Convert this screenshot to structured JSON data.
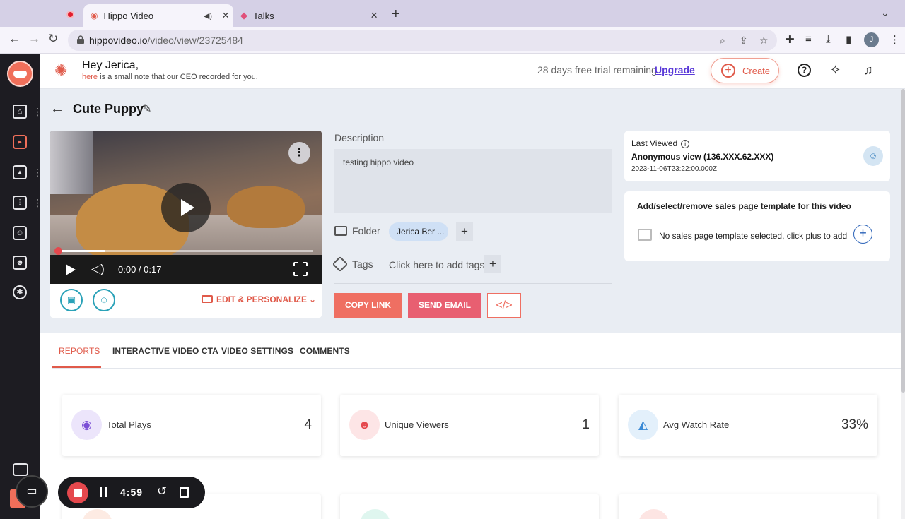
{
  "browser": {
    "tabs": [
      {
        "title": "Hippo Video",
        "active": true
      },
      {
        "title": "Talks",
        "active": false
      }
    ],
    "url_host": "hippovideo.io",
    "url_path": "/video/view/23725484",
    "profile_initial": "J"
  },
  "header": {
    "greeting": "Hey Jerica,",
    "note_link": "here",
    "note_rest": " is a small note that our CEO recorded for you.",
    "trial_text": "28 days free trial remaining.",
    "upgrade_label": "Upgrade",
    "create_label": "Create"
  },
  "video": {
    "title": "Cute Puppy",
    "time_display": "0:00 / 0:17",
    "progress": 0.18,
    "edit_personalize_label": "EDIT & PERSONALIZE"
  },
  "details": {
    "description_label": "Description",
    "description_text": "testing hippo video",
    "folder_label": "Folder",
    "folder_value": "Jerica Ber ...",
    "tags_label": "Tags",
    "tags_placeholder": "Click here to add tags",
    "copy_link_label": "COPY LINK",
    "send_email_label": "SEND EMAIL",
    "embed_label": "</>"
  },
  "last_viewed": {
    "label": "Last Viewed",
    "viewer": "Anonymous view (136.XXX.62.XXX)",
    "timestamp": "2023-11-06T23:22:00.000Z"
  },
  "sales_page": {
    "title": "Add/select/remove sales page template for this video",
    "empty_text": "No sales page template selected, click plus to add"
  },
  "report_tabs": [
    "REPORTS",
    "INTERACTIVE VIDEO CTA",
    "VIDEO SETTINGS",
    "COMMENTS"
  ],
  "stats": [
    {
      "label": "Total Plays",
      "value": "4",
      "icon": "eye-icon",
      "color": "#7b4fd6",
      "bg": "#ece5fb"
    },
    {
      "label": "Unique Viewers",
      "value": "1",
      "icon": "user-icon",
      "color": "#e5484d",
      "bg": "#fde5e6"
    },
    {
      "label": "Avg Watch Rate",
      "value": "33%",
      "icon": "area-chart-icon",
      "color": "#3a8ad6",
      "bg": "#e3f0fb"
    }
  ],
  "recorder": {
    "time": "4:59"
  },
  "colors": {
    "brand": "#f06f5a",
    "accent_link": "#5a3ad8"
  }
}
